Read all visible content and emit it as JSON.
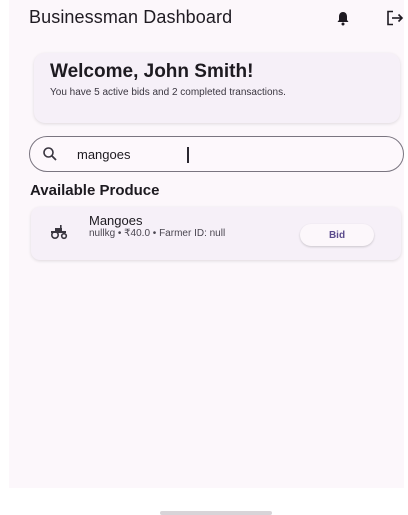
{
  "app_bar": {
    "title": "Businessman Dashboard",
    "notifications_icon": "bell-icon",
    "logout_icon": "logout-icon"
  },
  "welcome": {
    "title": "Welcome, John Smith!",
    "subtitle": "You have 5 active bids and 2 completed transactions."
  },
  "search": {
    "icon": "search-icon",
    "value": "mangoes"
  },
  "produce_section": {
    "title": "Available Produce",
    "items": [
      {
        "icon": "tractor-icon",
        "name": "Mangoes",
        "detail": "nullkg • ₹40.0 • Farmer ID: null",
        "action_label": "Bid"
      }
    ]
  },
  "colors": {
    "surface": "#fcf7fb",
    "card": "#f6f0f8",
    "accent": "#5a4a8c",
    "text": "#1d1a20"
  }
}
